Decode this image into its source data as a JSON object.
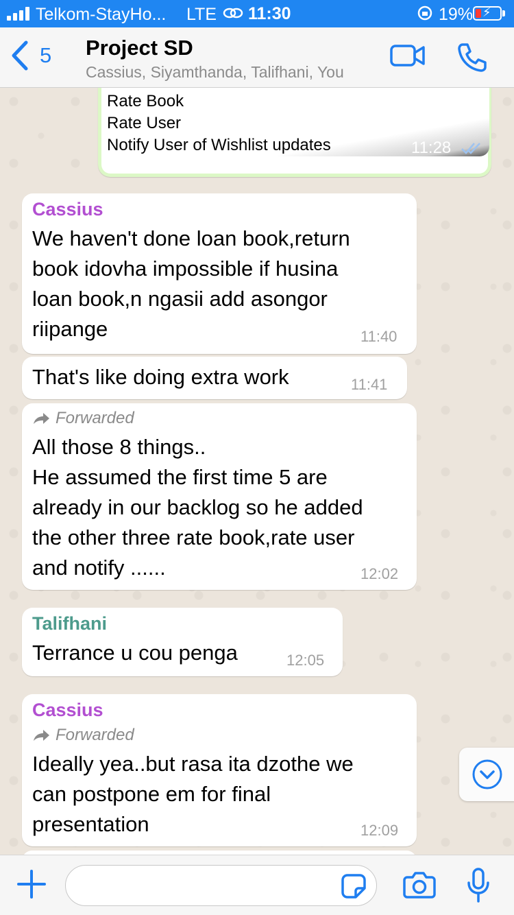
{
  "status_bar": {
    "carrier": "Telkom-StayHo...",
    "network": "LTE",
    "time": "11:30",
    "battery": "19%"
  },
  "header": {
    "back_count": "5",
    "title": "Project SD",
    "subtitle": "Cassius, Siyamthanda, Talifhani, You"
  },
  "messages": {
    "out": {
      "lines": [
        "Rate Book",
        "Rate User",
        "Notify User of Wishlist updates"
      ],
      "time": "11:28"
    },
    "m1": {
      "sender": "Cassius",
      "lines": [
        "We haven't done loan book,return",
        "book idovha impossible if husina",
        "loan book,n ngasii add asongor",
        "riipange"
      ],
      "time": "11:40"
    },
    "m2": {
      "text": "That's like doing extra work",
      "time": "11:41"
    },
    "m3": {
      "forwarded": "Forwarded",
      "lines": [
        "All those 8 things..",
        "He assumed the first time 5 are",
        "already in our backlog so he added",
        "the other three rate book,rate user",
        "and notify ......"
      ],
      "time": "12:02"
    },
    "m4": {
      "sender": "Talifhani",
      "text": "Terrance u cou penga",
      "time": "12:05"
    },
    "m5": {
      "sender": "Cassius",
      "forwarded": "Forwarded",
      "lines": [
        "Ideally yea..but rasa ita dzothe we",
        "can postpone em for final",
        "presentation"
      ],
      "time": "12:09"
    }
  },
  "colors": {
    "accent": "#1f7ef0",
    "cassius": "#b24fd1",
    "talifhani": "#4d9b8c",
    "outgoing_border": "#dcf8c6"
  },
  "icons": {
    "back": "chevron-left-icon",
    "video": "video-camera-icon",
    "call": "phone-icon",
    "plus": "plus-icon",
    "sticker": "sticker-icon",
    "camera": "camera-icon",
    "mic": "microphone-icon",
    "scroll": "chevron-down-circle-icon",
    "forward": "forward-arrow-icon",
    "read": "double-check-icon"
  }
}
